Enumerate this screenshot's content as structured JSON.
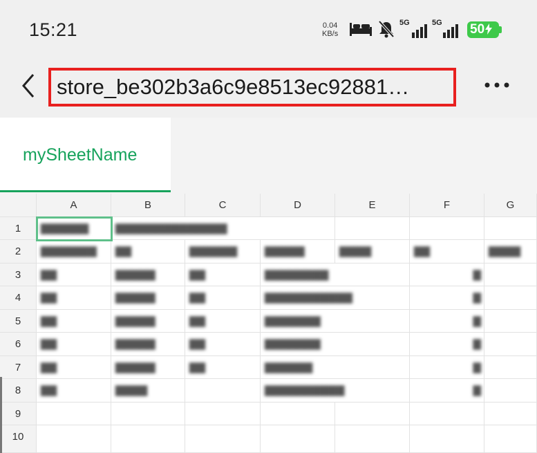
{
  "status_bar": {
    "time": "15:21",
    "net_speed_value": "0.04",
    "net_speed_unit": "KB/s",
    "signal_label_1": "5G",
    "signal_label_2": "5G",
    "battery_level": "50"
  },
  "header": {
    "title": "store_be302b3a6c9e8513ec92881…"
  },
  "sheet_tabs": [
    {
      "label": "mySheetName",
      "active": true
    }
  ],
  "columns": [
    "A",
    "B",
    "C",
    "D",
    "E",
    "F",
    "G"
  ],
  "rows": [
    "1",
    "2",
    "3",
    "4",
    "5",
    "6",
    "7",
    "8",
    "9",
    "10"
  ],
  "cells": {
    "r1": {
      "a": "▇▇▇▇▇▇",
      "b": "▇▇▇▇▇▇▇▇▇▇▇▇▇▇"
    },
    "r2": {
      "a": "▇▇▇▇▇▇▇",
      "b": "▇▇",
      "c": "▇▇▇▇▇▇",
      "d": "▇▇▇▇▇",
      "e": "▇▇▇▇",
      "f": "▇▇",
      "g": "▇▇▇▇"
    },
    "r3": {
      "a": "▇▇",
      "b": "▇▇▇▇▇",
      "c": "▇▇",
      "d": "▇▇▇▇▇▇▇▇",
      "f": "▇"
    },
    "r4": {
      "a": "▇▇",
      "b": "▇▇▇▇▇",
      "c": "▇▇",
      "d": "▇▇▇▇▇▇▇▇▇▇▇",
      "f": "▇"
    },
    "r5": {
      "a": "▇▇",
      "b": "▇▇▇▇▇",
      "c": "▇▇",
      "d": "▇▇▇▇▇▇▇",
      "f": "▇"
    },
    "r6": {
      "a": "▇▇",
      "b": "▇▇▇▇▇",
      "c": "▇▇",
      "d": "▇▇▇▇▇▇▇",
      "f": "▇"
    },
    "r7": {
      "a": "▇▇",
      "b": "▇▇▇▇▇",
      "c": "▇▇",
      "d": "▇▇▇▇▇▇",
      "f": "▇"
    },
    "r8": {
      "a": "▇▇",
      "b": "▇▇▇▇",
      "d": "▇▇▇▇▇▇▇▇▇▇",
      "f": "▇"
    }
  },
  "colors": {
    "accent_green": "#17a35c",
    "highlight_red": "#e8201f",
    "battery_green": "#3ec94a",
    "selection_green": "#5fc08a"
  },
  "icons": [
    "back-chevron-icon",
    "more-options-icon",
    "bed-icon",
    "mute-bell-icon",
    "signal-bars-icon",
    "charging-icon"
  ]
}
